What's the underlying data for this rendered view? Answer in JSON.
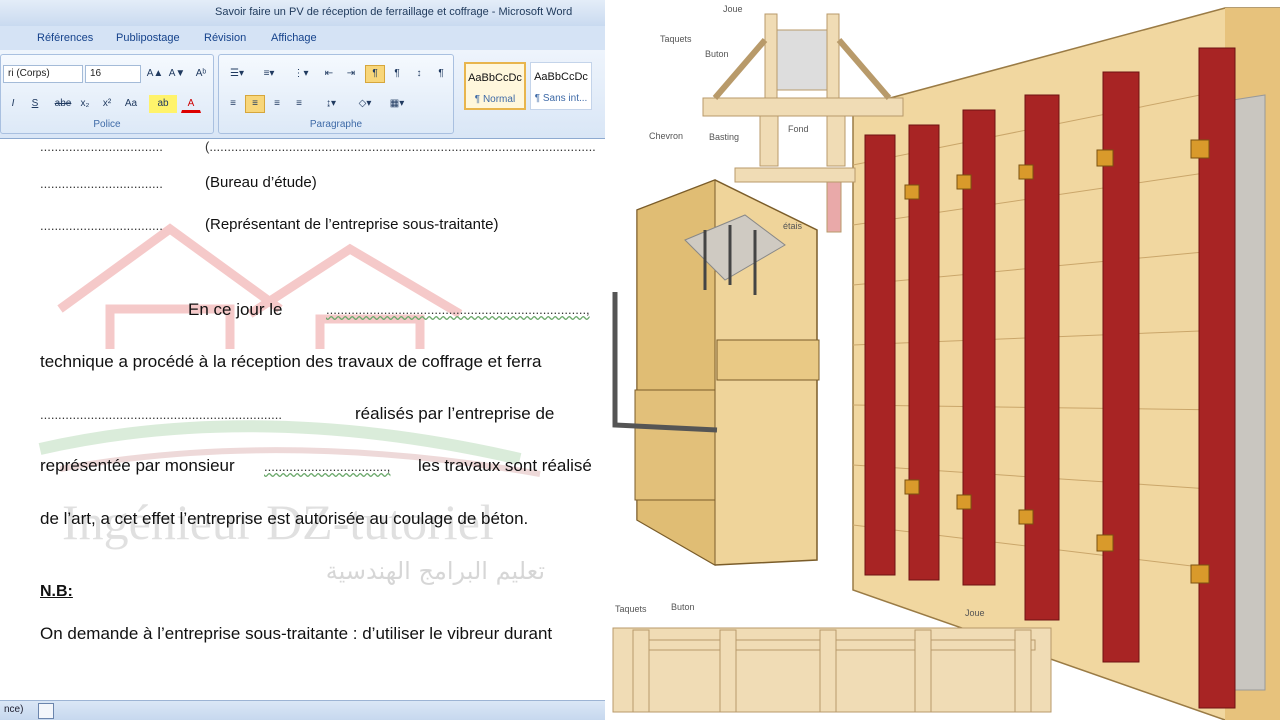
{
  "window": {
    "title": "Savoir faire un PV de réception de ferraillage et coffrage - Microsoft Word"
  },
  "tabs": [
    "Références",
    "Publipostage",
    "Révision",
    "Affichage"
  ],
  "ribbon": {
    "font_name": "ri (Corps)",
    "font_size": "16",
    "group_police": "Police",
    "group_paragraphe": "Paragraphe",
    "styles": [
      {
        "preview": "AaBbCcDc",
        "name": "¶ Normal"
      },
      {
        "preview": "AaBbCcDc",
        "name": "¶ Sans int..."
      }
    ]
  },
  "document": {
    "line1_dots": "..................................",
    "line1_tail": "(...........................................................................................................",
    "line2_dots": "..................................",
    "line2_text": "(Bureau d’étude)",
    "line3_dots": "..................................",
    "line3_text": "(Représentant de l’entreprise sous-traitante)",
    "para_intro": "En   ce   jour   le",
    "para_intro_dots": "........................................................................,",
    "para_l2": "technique a procédé à la réception des travaux de coffrage et ferra",
    "para_l3_dots": "...................................................................",
    "para_l3_text": "réalisés   par   l’entreprise   de",
    "para_l4_a": "représentée par monsieur",
    "para_l4_dots": "..................................,",
    "para_l4_b": "les travaux sont réalisé",
    "para_l5": "de l’art, a cet effet l’entreprise est autorisée au coulage de béton.",
    "nb_label": "N.B:",
    "nb_text": "On demande à l’entreprise sous-traitante : d’utiliser le vibreur durant",
    "watermark_latin": "Ingénieur DZ-tutoriel",
    "watermark_arabic": "تعليم البرامج الهندسية"
  },
  "status": {
    "left": "nce)"
  },
  "diagram_labels": {
    "joue": "Joue",
    "taquets": "Taquets",
    "buton": "Buton",
    "fond": "Fond",
    "chevron": "Chevron",
    "basting": "Basting",
    "etais": "étais",
    "taquets_bottom": "Taquets",
    "buton_bottom": "Buton",
    "joue_bottom": "Joue"
  }
}
